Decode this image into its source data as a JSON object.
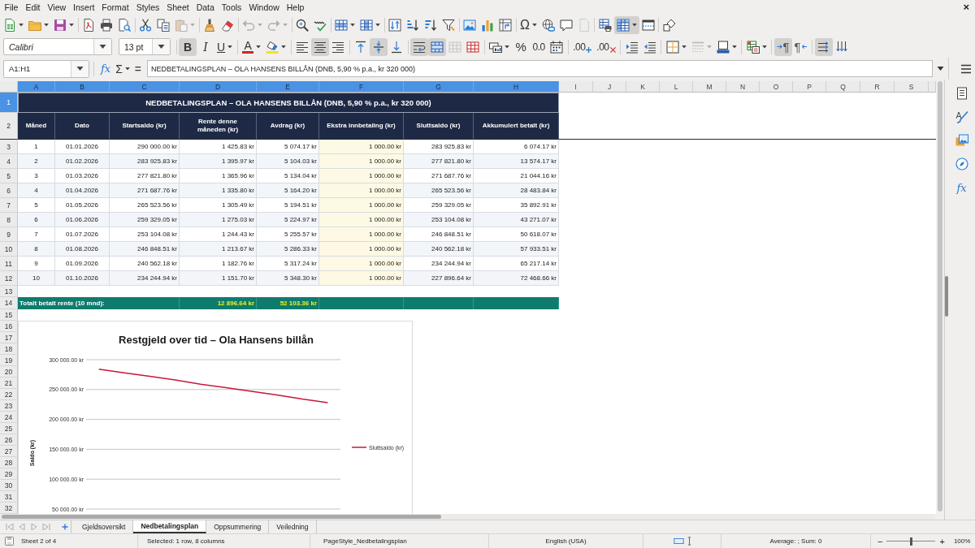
{
  "menu_bar": {
    "items": [
      "File",
      "Edit",
      "View",
      "Insert",
      "Format",
      "Styles",
      "Sheet",
      "Data",
      "Tools",
      "Window",
      "Help"
    ],
    "close": "×"
  },
  "standard_toolbar": [
    [
      {
        "kind": "new",
        "on": false,
        "disabled": false
      },
      {
        "kind": "open",
        "on": false,
        "disabled": false
      },
      {
        "kind": "save",
        "on": false,
        "disabled": false
      }
    ],
    [
      {
        "kind": "pdf",
        "on": false,
        "disabled": false
      },
      {
        "kind": "print",
        "on": false,
        "disabled": false
      },
      {
        "kind": "preview",
        "on": false,
        "disabled": false
      }
    ],
    [
      {
        "kind": "cut",
        "on": false,
        "disabled": false
      },
      {
        "kind": "copy",
        "on": false,
        "disabled": false
      },
      {
        "kind": "paste",
        "on": false,
        "disabled": true
      }
    ],
    [
      {
        "kind": "clone",
        "on": false,
        "disabled": false
      },
      {
        "kind": "clear",
        "on": false,
        "disabled": false
      }
    ],
    [
      {
        "kind": "undo",
        "on": false,
        "disabled": true
      },
      {
        "kind": "redo",
        "on": false,
        "disabled": true
      }
    ],
    [
      {
        "kind": "find",
        "on": false,
        "disabled": false
      },
      {
        "kind": "spelling",
        "on": false,
        "disabled": false
      }
    ],
    [
      {
        "kind": "rows",
        "on": false,
        "disabled": false
      },
      {
        "kind": "columns",
        "on": false,
        "disabled": false
      }
    ],
    [
      {
        "kind": "sort",
        "on": false,
        "disabled": false
      },
      {
        "kind": "ascending",
        "on": false,
        "disabled": false
      },
      {
        "kind": "descending",
        "on": false,
        "disabled": false
      },
      {
        "kind": "filter",
        "on": false,
        "disabled": false
      }
    ],
    [
      {
        "kind": "image",
        "on": false,
        "disabled": false
      },
      {
        "kind": "chart",
        "on": false,
        "disabled": false
      },
      {
        "kind": "pivot",
        "on": false,
        "disabled": false
      }
    ],
    [
      {
        "kind": "special",
        "label": "Ω",
        "on": false,
        "disabled": false
      },
      {
        "kind": "hyperlink",
        "on": false,
        "disabled": false
      },
      {
        "kind": "comment",
        "on": false,
        "disabled": false
      },
      {
        "kind": "headerfooter",
        "on": false,
        "disabled": true
      }
    ],
    [
      {
        "kind": "printarea",
        "on": false,
        "disabled": false
      },
      {
        "kind": "freeze",
        "on": true,
        "disabled": false
      },
      {
        "kind": "split",
        "on": false,
        "disabled": false
      }
    ],
    [
      {
        "kind": "draw",
        "on": false,
        "disabled": false
      }
    ]
  ],
  "formatting_toolbar": {
    "font_name": "Calibri",
    "font_size": "13 pt",
    "groups": [
      [
        {
          "kind": "bold",
          "label": "B",
          "on": true,
          "disabled": false
        },
        {
          "kind": "italic",
          "label": "I",
          "on": false,
          "disabled": false
        },
        {
          "kind": "underline",
          "label": "U",
          "on": false,
          "disabled": false
        }
      ],
      [
        {
          "kind": "fontcolor",
          "label": "A",
          "on": false,
          "disabled": false
        },
        {
          "kind": "highlight",
          "on": false,
          "disabled": false
        }
      ],
      [
        {
          "kind": "left",
          "on": false,
          "disabled": false
        },
        {
          "kind": "center",
          "on": true,
          "disabled": false
        },
        {
          "kind": "right",
          "on": false,
          "disabled": false
        }
      ],
      [
        {
          "kind": "top",
          "on": false,
          "disabled": false
        },
        {
          "kind": "middle",
          "on": true,
          "disabled": false
        },
        {
          "kind": "bottom",
          "on": false,
          "disabled": false
        }
      ],
      [
        {
          "kind": "wrap",
          "on": true,
          "disabled": false
        },
        {
          "kind": "mergecenter",
          "on": true,
          "disabled": false
        },
        {
          "kind": "merge",
          "on": false,
          "disabled": true
        },
        {
          "kind": "unmerge",
          "on": false,
          "disabled": false
        }
      ],
      [
        {
          "kind": "currency",
          "on": false,
          "disabled": false
        },
        {
          "kind": "percent",
          "label": "%",
          "on": false,
          "disabled": false
        },
        {
          "kind": "number",
          "label": "0.0",
          "on": false,
          "disabled": false
        },
        {
          "kind": "date",
          "on": false,
          "disabled": false
        }
      ],
      [
        {
          "kind": "adddecimal",
          "label": ".00",
          "on": false,
          "disabled": false
        },
        {
          "kind": "deletedecimal",
          "label": ".00",
          "on": false,
          "disabled": false
        }
      ],
      [
        {
          "kind": "indent",
          "on": false,
          "disabled": false
        },
        {
          "kind": "outdent",
          "on": false,
          "disabled": false
        }
      ],
      [
        {
          "kind": "borders",
          "on": false,
          "disabled": false
        },
        {
          "kind": "borderstyle",
          "on": false,
          "disabled": true
        },
        {
          "kind": "bordercolor",
          "on": false,
          "disabled": false
        }
      ],
      [
        {
          "kind": "conditional",
          "on": false,
          "disabled": false
        }
      ],
      [
        {
          "kind": "ltr",
          "label": "¶",
          "on": true,
          "disabled": false
        },
        {
          "kind": "rtl",
          "label": "¶",
          "on": false,
          "disabled": false
        }
      ],
      [
        {
          "kind": "horizontal",
          "on": true,
          "disabled": false
        },
        {
          "kind": "vertical",
          "on": false,
          "disabled": false
        }
      ]
    ]
  },
  "formula_bar": {
    "name_box": "A1:H1",
    "function_wizard": "fx",
    "sum": "Σ",
    "equals": "=",
    "content": "NEDBETALINGSPLAN – OLA HANSENS BILLÅN (DNB, 5,90 % p.a., kr 320 000)"
  },
  "sidebar": {
    "functions": "fx"
  },
  "sheet": {
    "columns": [
      {
        "label": "A",
        "selected": true
      },
      {
        "label": "B",
        "selected": true
      },
      {
        "label": "C",
        "selected": true
      },
      {
        "label": "D",
        "selected": true
      },
      {
        "label": "E",
        "selected": true
      },
      {
        "label": "F",
        "selected": true
      },
      {
        "label": "G",
        "selected": true
      },
      {
        "label": "H",
        "selected": true
      },
      {
        "label": "I",
        "selected": false
      },
      {
        "label": "J",
        "selected": false
      },
      {
        "label": "K",
        "selected": false
      },
      {
        "label": "L",
        "selected": false
      },
      {
        "label": "M",
        "selected": false
      },
      {
        "label": "N",
        "selected": false
      },
      {
        "label": "O",
        "selected": false
      },
      {
        "label": "P",
        "selected": false
      },
      {
        "label": "Q",
        "selected": false
      },
      {
        "label": "R",
        "selected": false
      },
      {
        "label": "S",
        "selected": false
      }
    ],
    "row_numbers": [
      {
        "label": "1",
        "selected": true
      },
      {
        "label": "2",
        "selected": false
      },
      {
        "label": "3",
        "selected": false
      },
      {
        "label": "4",
        "selected": false
      },
      {
        "label": "5",
        "selected": false
      },
      {
        "label": "6",
        "selected": false
      },
      {
        "label": "7",
        "selected": false
      },
      {
        "label": "8",
        "selected": false
      },
      {
        "label": "9",
        "selected": false
      },
      {
        "label": "10",
        "selected": false
      },
      {
        "label": "11",
        "selected": false
      },
      {
        "label": "12",
        "selected": false
      },
      {
        "label": "13",
        "selected": false
      },
      {
        "label": "14",
        "selected": false
      },
      {
        "label": "15",
        "selected": false
      },
      {
        "label": "16",
        "selected": false
      },
      {
        "label": "17",
        "selected": false
      },
      {
        "label": "18",
        "selected": false
      },
      {
        "label": "19",
        "selected": false
      },
      {
        "label": "20",
        "selected": false
      },
      {
        "label": "21",
        "selected": false
      },
      {
        "label": "22",
        "selected": false
      },
      {
        "label": "23",
        "selected": false
      },
      {
        "label": "24",
        "selected": false
      },
      {
        "label": "25",
        "selected": false
      },
      {
        "label": "26",
        "selected": false
      },
      {
        "label": "27",
        "selected": false
      },
      {
        "label": "28",
        "selected": false
      },
      {
        "label": "29",
        "selected": false
      },
      {
        "label": "30",
        "selected": false
      },
      {
        "label": "31",
        "selected": false
      },
      {
        "label": "32",
        "selected": false
      }
    ],
    "title": "NEDBETALINGSPLAN – OLA HANSENS BILLÅN (DNB, 5,90 % p.a., kr 320 000)",
    "headers": [
      {
        "text": "Måned",
        "highlighted": false
      },
      {
        "text": "Dato",
        "highlighted": false
      },
      {
        "text": "Startsaldo (kr)",
        "highlighted": false
      },
      {
        "text": "Rente denne måneden (kr)",
        "highlighted": false
      },
      {
        "text": "Avdrag (kr)",
        "highlighted": false
      },
      {
        "text": "Ekstra innbetaling (kr)",
        "highlighted": true
      },
      {
        "text": "Sluttsaldo (kr)",
        "highlighted": false
      },
      {
        "text": "Akkumulert betalt (kr)",
        "highlighted": false
      }
    ],
    "rows": [
      [
        "1",
        "01.01.2026",
        "290 000.00 kr",
        "1 425.83 kr",
        "5 074.17 kr",
        "1 000.00 kr",
        "283 925.83 kr",
        "6 074.17 kr"
      ],
      [
        "2",
        "01.02.2026",
        "283 925.83 kr",
        "1 395.97 kr",
        "5 104.03 kr",
        "1 000.00 kr",
        "277 821.80 kr",
        "13 574.17 kr"
      ],
      [
        "3",
        "01.03.2026",
        "277 821.80 kr",
        "1 365.96 kr",
        "5 134.04 kr",
        "1 000.00 kr",
        "271 687.76 kr",
        "21 044.16 kr"
      ],
      [
        "4",
        "01.04.2026",
        "271 687.76 kr",
        "1 335.80 kr",
        "5 164.20 kr",
        "1 000.00 kr",
        "265 523.56 kr",
        "28 483.84 kr"
      ],
      [
        "5",
        "01.05.2026",
        "265 523.56 kr",
        "1 305.49 kr",
        "5 194.51 kr",
        "1 000.00 kr",
        "259 329.05 kr",
        "35 892.91 kr"
      ],
      [
        "6",
        "01.06.2026",
        "259 329.05 kr",
        "1 275.03 kr",
        "5 224.97 kr",
        "1 000.00 kr",
        "253 104.08 kr",
        "43 271.07 kr"
      ],
      [
        "7",
        "01.07.2026",
        "253 104.08 kr",
        "1 244.43 kr",
        "5 255.57 kr",
        "1 000.00 kr",
        "246 848.51 kr",
        "50 618.07 kr"
      ],
      [
        "8",
        "01.08.2026",
        "246 848.51 kr",
        "1 213.67 kr",
        "5 286.33 kr",
        "1 000.00 kr",
        "240 562.18 kr",
        "57 933.51 kr"
      ],
      [
        "9",
        "01.09.2026",
        "240 562.18 kr",
        "1 182.76 kr",
        "5 317.24 kr",
        "1 000.00 kr",
        "234 244.94 kr",
        "65 217.14 kr"
      ],
      [
        "10",
        "01.10.2026",
        "234 244.94 kr",
        "1 151.70 kr",
        "5 348.30 kr",
        "1 000.00 kr",
        "227 896.64 kr",
        "72 468.66 kr"
      ]
    ],
    "total_row": {
      "label": "Totalt betalt rente (10 mnd):",
      "interest": "12 896.64 kr",
      "principal": "52 103.36 kr"
    },
    "chart": {
      "chart_data": {
        "type": "line",
        "title": "Restgjeld over tid – Ola Hansens billån",
        "ylabel": "Saldo (kr)",
        "ylim": [
          50000,
          300000
        ],
        "yticks": [
          {
            "value": 300000,
            "label": "300 000.00 kr"
          },
          {
            "value": 250000,
            "label": "250 000.00 kr"
          },
          {
            "value": 200000,
            "label": "200 000.00 kr"
          },
          {
            "value": 150000,
            "label": "150 000.00 kr"
          },
          {
            "value": 100000,
            "label": "100 000.00 kr"
          },
          {
            "value": 50000,
            "label": "50 000.00 kr"
          }
        ],
        "grid": true,
        "series": [
          {
            "name": "Sluttsaldo (kr)",
            "color": "#c8173a",
            "values": [
              284000,
              278000,
              272000,
              266000,
              259000,
              253000,
              247000,
              241000,
              234000,
              228000
            ]
          }
        ]
      }
    }
  },
  "sheet_tabs": [
    {
      "label": "Gjeldsoversikt",
      "selected": false
    },
    {
      "label": "Nedbetalingsplan",
      "selected": true
    },
    {
      "label": "Oppsummering",
      "selected": false
    },
    {
      "label": "Veiledning",
      "selected": false
    }
  ],
  "status_bar": {
    "sheet": "Sheet 2 of 4",
    "selection": "Selected: 1 row, 8 columns",
    "page_style": "PageStyle_Nedbetalingsplan",
    "language": "English (USA)",
    "summary": "Average: ; Sum: 0",
    "zoom_out": "−",
    "zoom_slider": {
      "level": 0.5
    },
    "zoom_in": "+",
    "zoom": "100%"
  }
}
